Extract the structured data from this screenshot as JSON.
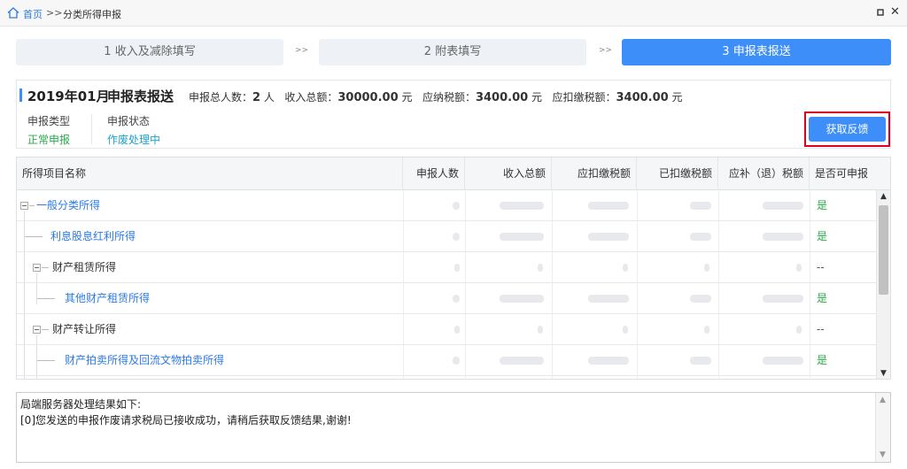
{
  "titlebar": {
    "home_label": "首页",
    "separator": ">>",
    "current": "分类所得申报",
    "maximize_icon": "maximize-icon",
    "close_glyph": "✕"
  },
  "steps": [
    {
      "label": "1 收入及减除填写",
      "active": false
    },
    {
      "label": "2 附表填写",
      "active": false
    },
    {
      "label": "3 申报表报送",
      "active": true
    }
  ],
  "step_arrow": ">>",
  "report": {
    "period": "2019年01月",
    "title": "申报表报送",
    "summary": {
      "people_label": "申报总人数：",
      "people_value": "2",
      "people_unit": "人",
      "income_label": "收入总额：",
      "income_value": "30000.00",
      "income_unit": "元",
      "tax_payable_label": "应纳税额：",
      "tax_payable_value": "3400.00",
      "tax_payable_unit": "元",
      "tax_withhold_label": "应扣缴税额：",
      "tax_withhold_value": "3400.00",
      "tax_withhold_unit": "元"
    },
    "type_label": "申报类型",
    "type_value": "正常申报",
    "status_label": "申报状态",
    "status_value": "作废处理中",
    "feedback_button": "获取反馈"
  },
  "table": {
    "columns": [
      "所得项目名称",
      "申报人数",
      "收入总额",
      "应扣缴税额",
      "已扣缴税额",
      "应补（退）税额",
      "是否可申报"
    ],
    "rows": [
      {
        "name": "一般分类所得",
        "can_declare": "是"
      },
      {
        "name": "利息股息红利所得",
        "can_declare": "是"
      },
      {
        "name": "财产租赁所得",
        "can_declare": "--"
      },
      {
        "name": "其他财产租赁所得",
        "can_declare": "是"
      },
      {
        "name": "财产转让所得",
        "can_declare": "--"
      },
      {
        "name": "财产拍卖所得及回流文物拍卖所得",
        "can_declare": "是"
      }
    ]
  },
  "output": {
    "line1": "局端服务器处理结果如下:",
    "line2": "[0]您发送的申报作废请求税局已接收成功，请稍后获取反馈结果,谢谢!"
  },
  "colors": {
    "accent": "#3d8ef8",
    "link": "#2c7be5",
    "ok_green": "#2aa84a",
    "status_cyan": "#1aa3c9",
    "highlight_red": "#e0001b"
  }
}
